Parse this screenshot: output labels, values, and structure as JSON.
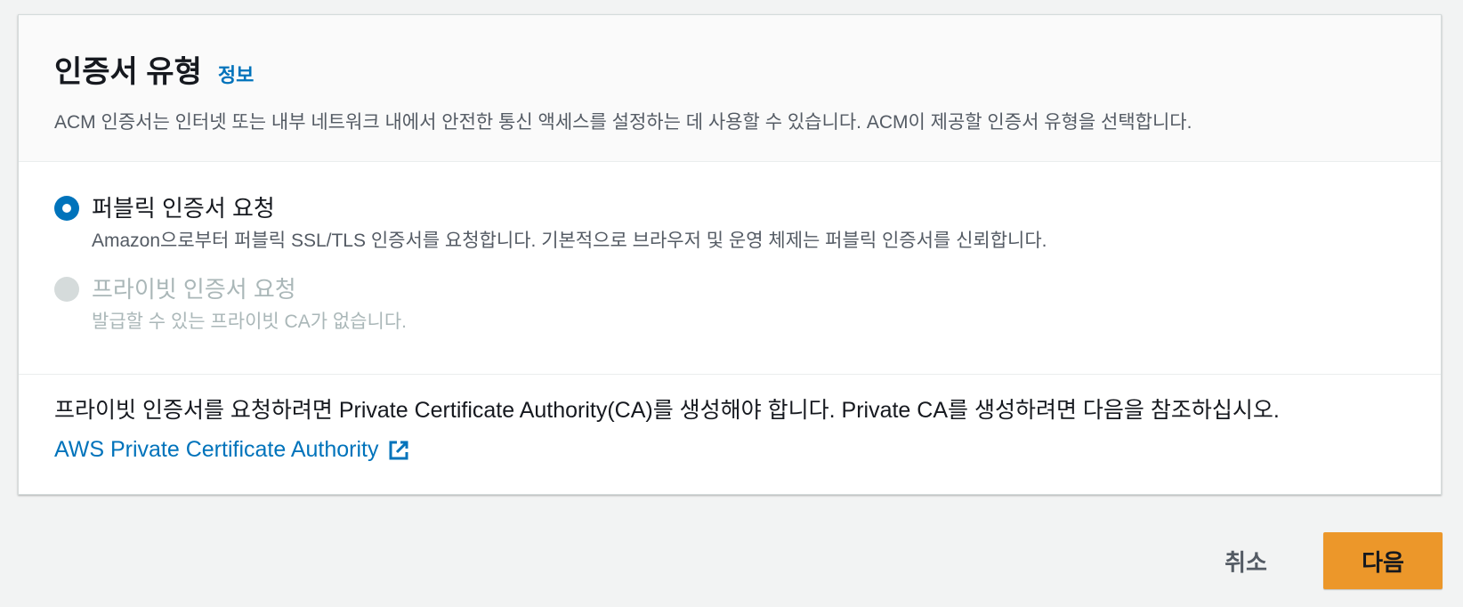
{
  "header": {
    "title": "인증서 유형",
    "info_link": "정보",
    "description": "ACM 인증서는 인터넷 또는 내부 네트워크 내에서 안전한 통신 액세스를 설정하는 데 사용할 수 있습니다. ACM이 제공할 인증서 유형을 선택합니다."
  },
  "options": [
    {
      "label": "퍼블릭 인증서 요청",
      "description": "Amazon으로부터 퍼블릭 SSL/TLS 인증서를 요청합니다. 기본적으로 브라우저 및 운영 체제는 퍼블릭 인증서를 신뢰합니다.",
      "selected": true,
      "disabled": false
    },
    {
      "label": "프라이빗 인증서 요청",
      "description": "발급할 수 있는 프라이빗 CA가 없습니다.",
      "selected": false,
      "disabled": true
    }
  ],
  "note": {
    "text": "프라이빗 인증서를 요청하려면 Private Certificate Authority(CA)를 생성해야 합니다. Private CA를 생성하려면 다음을 참조하십시오.",
    "link_label": "AWS Private Certificate Authority",
    "link_icon": "external-link-icon"
  },
  "actions": {
    "cancel_label": "취소",
    "next_label": "다음"
  },
  "colors": {
    "accent": "#0073bb",
    "primary_button": "#ec972a",
    "background": "#f2f3f3",
    "disabled": "#aab7b8"
  }
}
